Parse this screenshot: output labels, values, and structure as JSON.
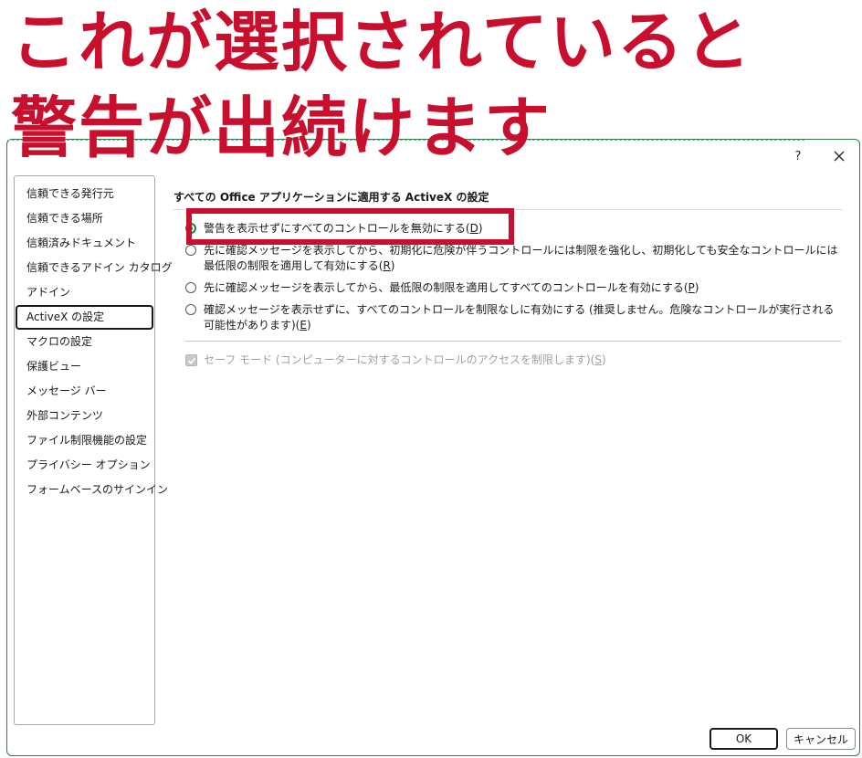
{
  "overlay": {
    "line1": "これが選択されていると",
    "line2": "警告が出続けます"
  },
  "titlebar": {
    "help_label": "?"
  },
  "sidebar": {
    "items": [
      {
        "label": "信頼できる発行元"
      },
      {
        "label": "信頼できる場所"
      },
      {
        "label": "信頼済みドキュメント"
      },
      {
        "label": "信頼できるアドイン カタログ"
      },
      {
        "label": "アドイン"
      },
      {
        "label": "ActiveX の設定"
      },
      {
        "label": "マクロの設定"
      },
      {
        "label": "保護ビュー"
      },
      {
        "label": "メッセージ バー"
      },
      {
        "label": "外部コンテンツ"
      },
      {
        "label": "ファイル制限機能の設定"
      },
      {
        "label": "プライバシー オプション"
      },
      {
        "label": "フォームベースのサインイン"
      }
    ],
    "selected": "ActiveX の設定"
  },
  "main": {
    "section_title": "すべての Office アプリケーションに適用する ActiveX の設定",
    "options": [
      {
        "text": "警告を表示せずにすべてのコントロールを無効にする(",
        "key": "D",
        "tail": ")",
        "selected": true
      },
      {
        "text": "先に確認メッセージを表示してから、初期化に危険が伴うコントロールには制限を強化し、初期化しても安全なコントロールには最低限の制限を適用して有効にする(",
        "key": "R",
        "tail": ")",
        "selected": false
      },
      {
        "text": "先に確認メッセージを表示してから、最低限の制限を適用してすべてのコントロールを有効にする(",
        "key": "P",
        "tail": ")",
        "selected": false
      },
      {
        "text": "確認メッセージを表示せずに、すべてのコントロールを制限なしに有効にする (推奨しません。危険なコントロールが実行される可能性があります)(",
        "key": "E",
        "tail": ")",
        "selected": false
      }
    ],
    "safe_mode": {
      "text": "セーフ モード (コンピューターに対するコントロールのアクセスを制限します)(",
      "key": "S",
      "tail": ")",
      "checked": true,
      "disabled": true
    }
  },
  "buttons": {
    "ok": "OK",
    "cancel": "キャンセル"
  },
  "colors": {
    "highlight": "#c8102e",
    "accent": "#1f7a45"
  }
}
